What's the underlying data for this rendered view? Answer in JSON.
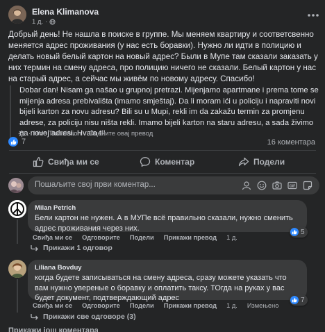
{
  "post": {
    "author": "Elena Klimanova",
    "time": "1 д.",
    "text": "Добрый день! Не нашла в поиске в группе. Мы меняем квартиру и соответсвенно меняется адрес проживания (у нас есть боравки). Нужно ли идти в полицию и делать новый белый картон на новый адрес? Были в Мупе там сказали заказать у них термин на смену адреса,  про полицию ничего не сказали. Белый картон у нас на старый адрес, а сейчас мы живём по новому адресу. Спасибо!",
    "translation": "Dobar dan! Nisam ga našao u grupnoj pretrazi. Mijenjamo apartmane i prema tome se mijenja adresa prebivališta (imamo smještaj). Da li moram ići u policiju i napraviti novi bijeli karton za novu adresu? Bili su u Mupi, rekli im da zakažu termin za promjenu adrese, za policiju nisu ništa rekli. Imamo bijeli karton na staru adresu, a sada živimo na novoj adresi. Hvala ti!",
    "hide_translation": "Hide Translation",
    "rate_translation": "Оцените овај превод",
    "reaction_count": "7",
    "comment_count": "16 коментара"
  },
  "actions": {
    "like": "Свиђа ми се",
    "comment": "Коментар",
    "share": "Подели"
  },
  "comment_box": {
    "placeholder": "Пошаљите свој први коментар..."
  },
  "comments": [
    {
      "author": "Milan Petrich",
      "text": "Бели картон не нужен. А в МУПе всё правильно сказали, нужно сменить адрес проживания через них.",
      "like": "Свиђа ми се",
      "reply": "Одговорите",
      "share": "Подели",
      "show_translation": "Прикажи превод",
      "time": "1 д.",
      "reactions": "5",
      "replies": "Прикажи 1 одговор"
    },
    {
      "author": "Liliana Bovduy",
      "text": "когда будете записываться на смену адреса, сразу можете указать что вам нужно увереные о боравку и оплатить таксу. ТОгда на руках у вас будет документ, подтверждающий адрес",
      "like": "Свиђа ми се",
      "reply": "Одговорите",
      "share": "Подели",
      "show_translation": "Прикажи превод",
      "time": "1 д.",
      "edited": "Измењено",
      "reactions": "7",
      "replies": "Прикажи све одговоре (3)"
    }
  ],
  "more_comments": "Прикажи још коментара",
  "colors": {
    "background": "#242526",
    "bubble": "#3a3b3c",
    "like_blue": "#2d88ff"
  }
}
